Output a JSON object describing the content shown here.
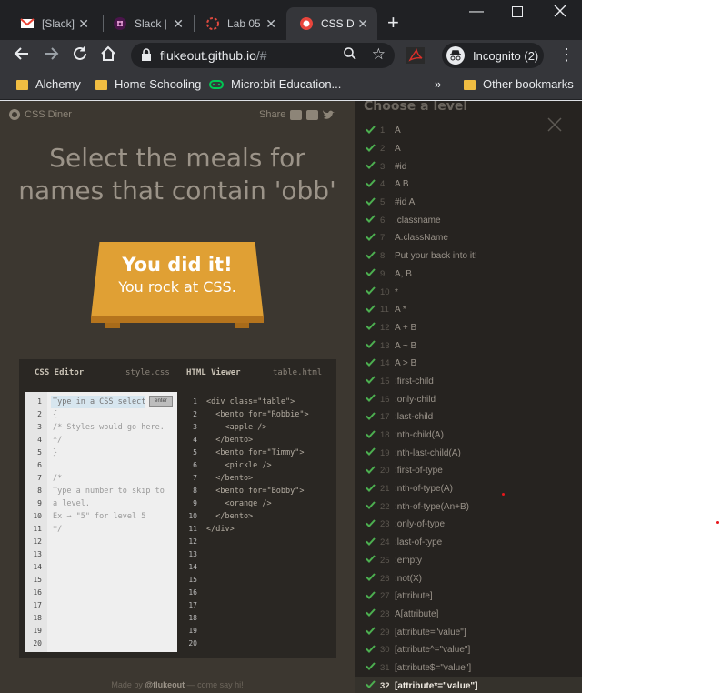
{
  "browser": {
    "tabs": [
      {
        "label": "[Slack]",
        "icon": "gmail-icon"
      },
      {
        "label": "Slack |",
        "icon": "slack-icon"
      },
      {
        "label": "Lab 05:",
        "icon": "loading-icon"
      },
      {
        "label": "CSS Dir",
        "icon": "css-diner-icon",
        "active": true
      }
    ],
    "url_host": "flukeout.github.io",
    "url_path": "/#",
    "incognito_label": "Incognito (2)",
    "bookmarks": [
      {
        "label": "Alchemy",
        "icon": "folder-icon"
      },
      {
        "label": "Home Schooling",
        "icon": "folder-icon"
      },
      {
        "label": "Micro:bit Education...",
        "icon": "microbit-icon"
      }
    ],
    "other_bookmarks": "Other bookmarks",
    "overflow": "»"
  },
  "diner": {
    "logo": "CSS Diner",
    "share": "Share",
    "headline_line1": "Select the meals for",
    "headline_line2": "names that contain 'obb'",
    "win_title": "You did it!",
    "win_sub": "You rock at CSS.",
    "footer_prefix": "Made by ",
    "footer_author": "@flukeout",
    "footer_suffix": " — come say hi!"
  },
  "editor": {
    "css_title": "CSS Editor",
    "css_file": "style.css",
    "html_title": "HTML Viewer",
    "html_file": "table.html",
    "input_placeholder": "Type in a CSS selector",
    "enter_label": "enter",
    "line_numbers": [
      "1",
      "2",
      "3",
      "4",
      "5",
      "6",
      "7",
      "8",
      "9",
      "10",
      "11",
      "12",
      "13",
      "14",
      "15",
      "16",
      "17",
      "18",
      "19",
      "20"
    ],
    "css_lines": [
      "",
      "{",
      "/* Styles would go here.",
      "*/",
      "}",
      "",
      "/*",
      "Type a number to skip to",
      "a level.",
      "Ex → \"5\" for level 5",
      "*/"
    ],
    "html_lines": [
      "<div class=\"table\">",
      "  <bento for=\"Robbie\">",
      "    <apple />",
      "  </bento>",
      "  <bento for=\"Timmy\">",
      "    <pickle />",
      "  </bento>",
      "  <bento for=\"Bobby\">",
      "    <orange />",
      "  </bento>",
      "</div>"
    ]
  },
  "levels_panel": {
    "title": "Choose a level",
    "check_color": "#4caf50",
    "levels": [
      {
        "num": "1",
        "name": "A"
      },
      {
        "num": "2",
        "name": "A"
      },
      {
        "num": "3",
        "name": "#id"
      },
      {
        "num": "4",
        "name": "A  B"
      },
      {
        "num": "5",
        "name": "#id  A"
      },
      {
        "num": "6",
        "name": ".classname"
      },
      {
        "num": "7",
        "name": "A.className"
      },
      {
        "num": "8",
        "name": "Put your back into it!"
      },
      {
        "num": "9",
        "name": "A, B"
      },
      {
        "num": "10",
        "name": "*"
      },
      {
        "num": "11",
        "name": "A  *"
      },
      {
        "num": "12",
        "name": "A + B"
      },
      {
        "num": "13",
        "name": "A ~ B"
      },
      {
        "num": "14",
        "name": "A > B"
      },
      {
        "num": "15",
        "name": ":first-child"
      },
      {
        "num": "16",
        "name": ":only-child"
      },
      {
        "num": "17",
        "name": ":last-child"
      },
      {
        "num": "18",
        "name": ":nth-child(A)"
      },
      {
        "num": "19",
        "name": ":nth-last-child(A)"
      },
      {
        "num": "20",
        "name": ":first-of-type"
      },
      {
        "num": "21",
        "name": ":nth-of-type(A)"
      },
      {
        "num": "22",
        "name": ":nth-of-type(An+B)"
      },
      {
        "num": "23",
        "name": ":only-of-type"
      },
      {
        "num": "24",
        "name": ":last-of-type"
      },
      {
        "num": "25",
        "name": ":empty"
      },
      {
        "num": "26",
        "name": ":not(X)"
      },
      {
        "num": "27",
        "name": "[attribute]"
      },
      {
        "num": "28",
        "name": "A[attribute]"
      },
      {
        "num": "29",
        "name": "[attribute=\"value\"]"
      },
      {
        "num": "30",
        "name": "[attribute^=\"value\"]"
      },
      {
        "num": "31",
        "name": "[attribute$=\"value\"]"
      },
      {
        "num": "32",
        "name": "[attribute*=\"value\"]",
        "current": true
      }
    ]
  }
}
